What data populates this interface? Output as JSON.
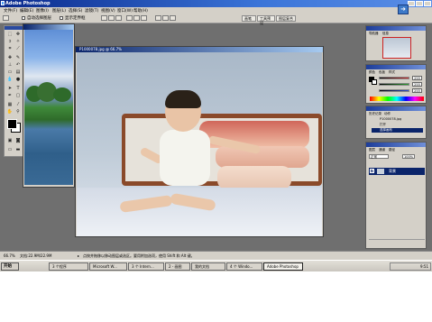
{
  "app": {
    "title": "Adobe Photoshop"
  },
  "menu": [
    "文件(F)",
    "编辑(E)",
    "图像(I)",
    "图层(L)",
    "选择(S)",
    "滤镜(T)",
    "视图(V)",
    "窗口(W)",
    "帮助(H)"
  ],
  "options": {
    "auto_select": "自动选择图层",
    "show_bounds": "显示定界框",
    "right_tabs": [
      "画笔",
      "工具预设",
      "图层复合"
    ]
  },
  "documents": {
    "landscape": {
      "title": ""
    },
    "photo": {
      "title": "P1000078.jpg @ 66.7%"
    }
  },
  "panels": {
    "navigator": {
      "tabs": [
        "导航器",
        "信息"
      ]
    },
    "color": {
      "tabs": [
        "颜色",
        "色板",
        "样式"
      ],
      "sliders": [
        {
          "label": "R",
          "value": "255",
          "color": "#d43030"
        },
        {
          "label": "G",
          "value": "255",
          "color": "#30a030"
        },
        {
          "label": "B",
          "value": "255",
          "color": "#3050d0"
        }
      ]
    },
    "history": {
      "tabs": [
        "历史记录",
        "动作"
      ],
      "items": [
        "P1000078.jpg",
        "打开",
        "选择画布"
      ]
    },
    "layers": {
      "tabs": [
        "图层",
        "通道",
        "路径"
      ],
      "blend_mode": "正常",
      "opacity": "100%",
      "layer_name": "背景"
    }
  },
  "status": {
    "zoom": "66.7%",
    "doc_size": "文档:22.9M/22.9M",
    "hint": "点按并拖移以移动图层或选区。要用附加选项，使用 Shift 和 Alt 键。"
  },
  "taskbar": {
    "start": "开始",
    "tasks": [
      "3 个程序",
      "Microsoft W...",
      "3 个 Intern...",
      "2 - 画图",
      "我的文档",
      "4 个 Windo...",
      "Adobe Photoshop"
    ],
    "tray_time": "9:51"
  }
}
